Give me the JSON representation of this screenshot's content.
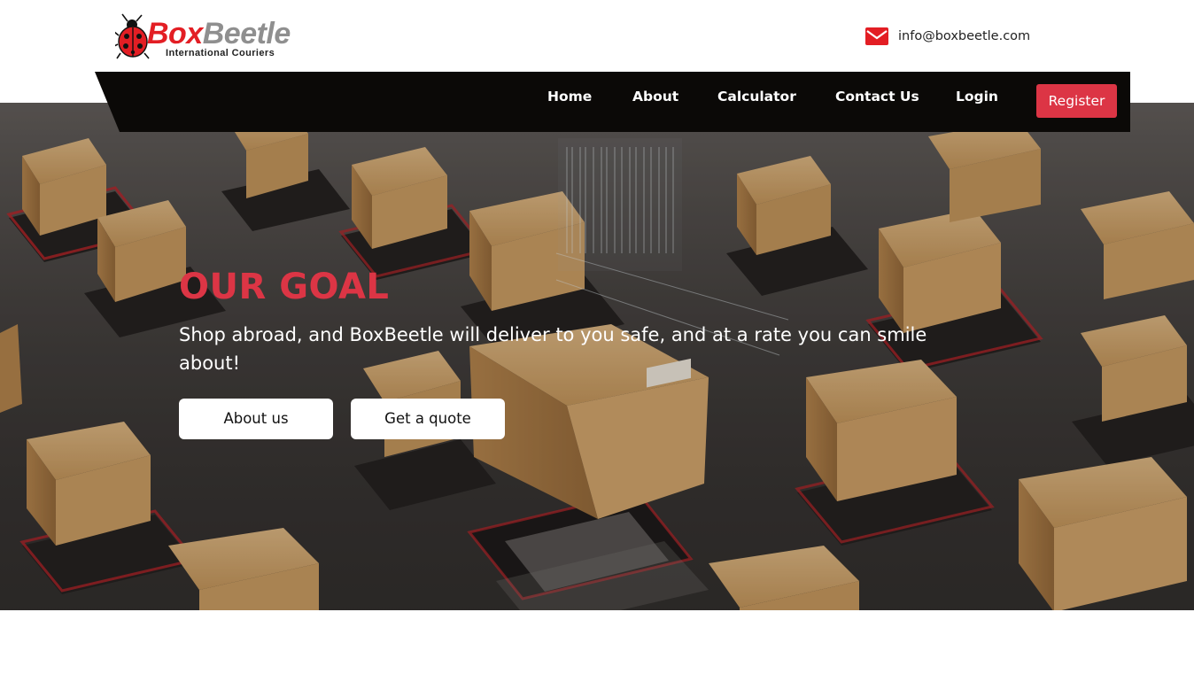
{
  "header": {
    "logo": {
      "brand_first": "Box",
      "brand_second": "Beetle",
      "tagline": "International Couriers",
      "icon": "ladybug-icon"
    },
    "contact": {
      "icon": "envelope-icon",
      "email": "info@boxbeetle.com"
    }
  },
  "nav": {
    "items": [
      {
        "label": "Home"
      },
      {
        "label": "About"
      },
      {
        "label": "Calculator"
      },
      {
        "label": "Contact Us"
      },
      {
        "label": "Login"
      }
    ],
    "register_label": "Register"
  },
  "hero": {
    "title": "OUR GOAL",
    "text": "Shop abroad, and BoxBeetle will deliver to you safe, and at a rate you can smile about!",
    "buttons": [
      {
        "label": "About us"
      },
      {
        "label": "Get a quote"
      }
    ]
  },
  "colors": {
    "accent": "#dc3545",
    "logo_red": "#e31e24",
    "logo_grey": "#8f8f8f",
    "navbar": "#0b0907"
  }
}
